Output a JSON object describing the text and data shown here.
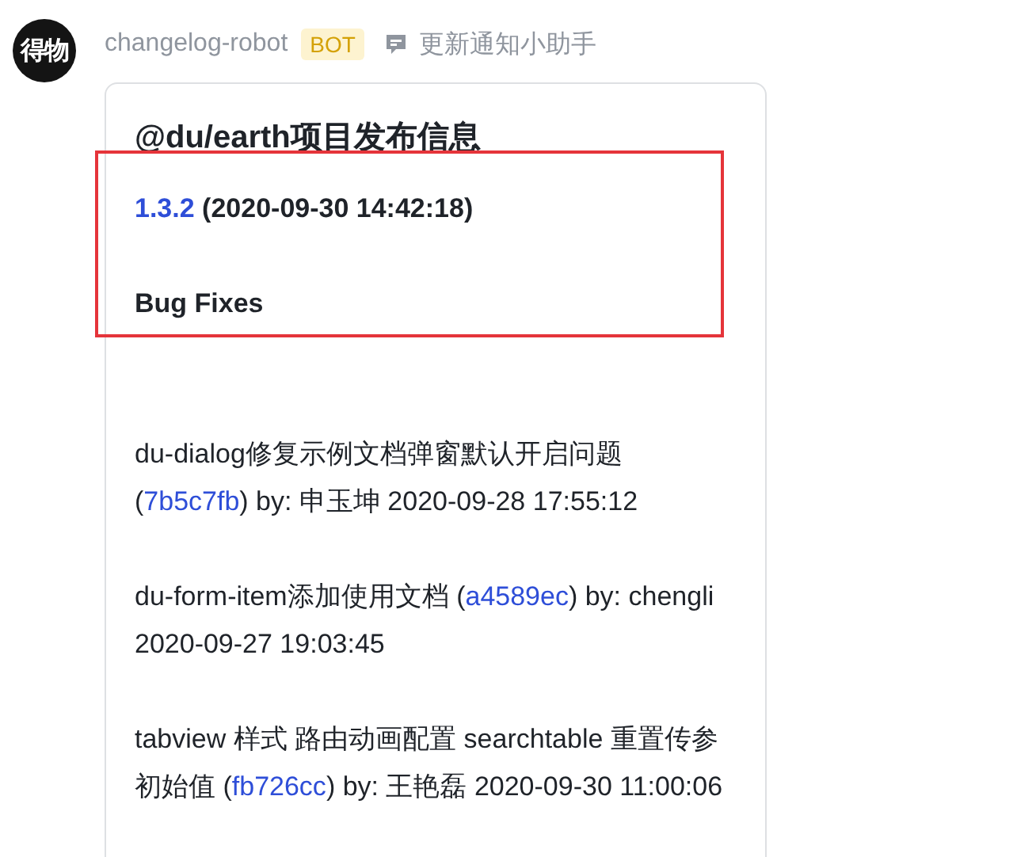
{
  "sender": {
    "avatar_text": "得物",
    "name": "changelog-robot",
    "badge": "BOT",
    "app_name": "更新通知小助手"
  },
  "message": {
    "title": "@du/earth项目发布信息",
    "version": "1.3.2",
    "release_time": "(2020-09-30 14:42:18)",
    "section": "Bug Fixes",
    "highlighted": true,
    "commits": [
      {
        "before": "du-dialog修复示例文档弹窗默认开启问题 (",
        "hash": "7b5c7fb",
        "after": ") by: 申玉坤 2020-09-28 17:55:12"
      },
      {
        "before": "du-form-item添加使用文档 (",
        "hash": "a4589ec",
        "after": ") by: chengli 2020-09-27 19:03:45"
      },
      {
        "before": "tabview 样式 路由动画配置 searchtable 重置传参初始值 (",
        "hash": "fb726cc",
        "after": ") by: 王艳磊 2020-09-30 11:00:06"
      }
    ]
  }
}
